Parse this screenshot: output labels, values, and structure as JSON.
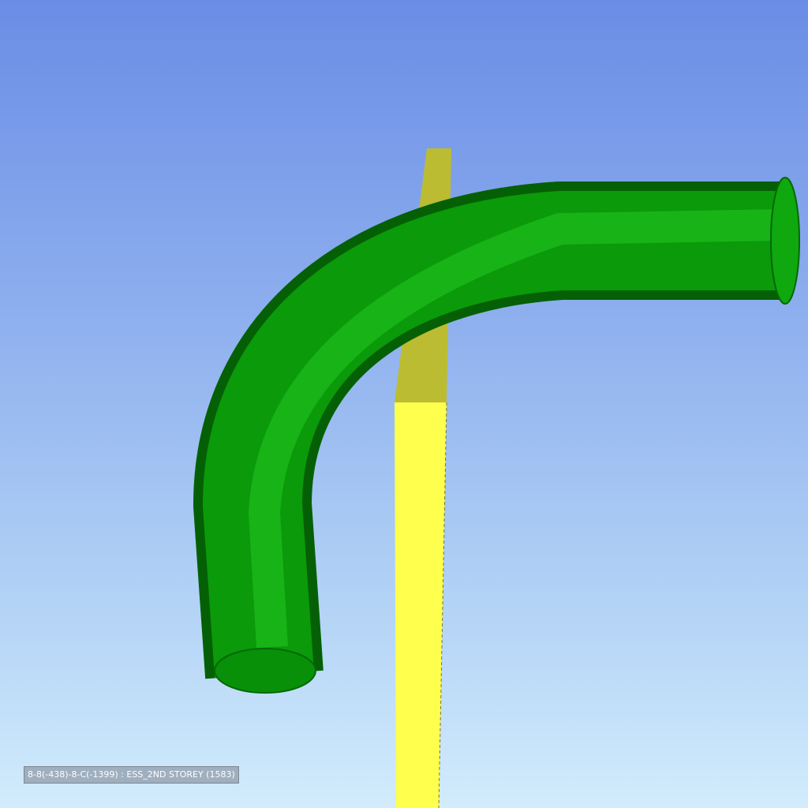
{
  "viewer": {
    "background_top_color": "#6a8de6",
    "background_bottom_color": "#d2ecfc",
    "status_label": "8-8(-438)-8-C(-1399) : ESS_2ND STOREY (1583)"
  },
  "scene": {
    "objects": [
      {
        "name": "pipe-elbow",
        "shape": "curved pipe elbow",
        "color": "#12a012"
      },
      {
        "name": "column-segment",
        "shape": "rectangular column",
        "color": "#ffff4d"
      }
    ]
  }
}
